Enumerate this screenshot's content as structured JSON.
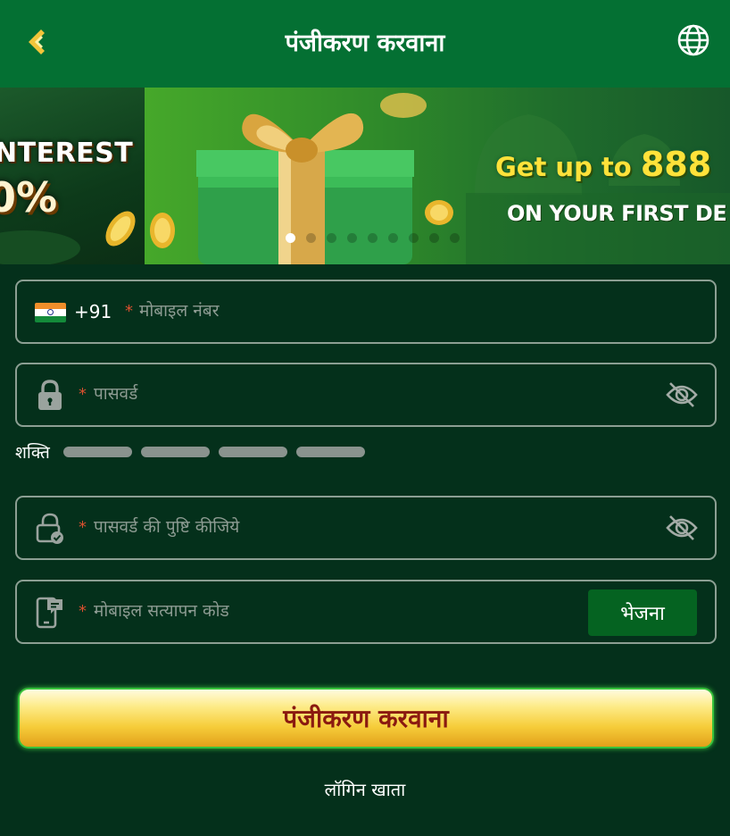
{
  "header": {
    "title": "पंजीकरण करवाना"
  },
  "banner": {
    "left_line1": "NTEREST",
    "left_line2": "0%",
    "right_line1_prefix": "Get up to",
    "right_line1_amount": "888",
    "right_line2": "ON YOUR FIRST DE",
    "slide_count": 9,
    "active_slide": 1
  },
  "form": {
    "phone": {
      "country_code": "+91",
      "required_mark": "*",
      "placeholder": "मोबाइल नंबर"
    },
    "password": {
      "required_mark": "*",
      "placeholder": "पासवर्ड"
    },
    "strength": {
      "label": "शक्ति",
      "segments": 4
    },
    "confirm_password": {
      "required_mark": "*",
      "placeholder": "पासवर्ड की पुष्टि कीजिये"
    },
    "otp": {
      "required_mark": "*",
      "placeholder": "मोबाइल सत्यापन कोड",
      "send_label": "भेजना"
    }
  },
  "actions": {
    "register_label": "पंजीकरण करवाना",
    "login_label": "लॉगिन खाता"
  },
  "colors": {
    "header_bg": "#047033",
    "page_bg": "#04301b",
    "field_border": "#8c9f93",
    "send_bg": "#056321",
    "register_text": "#8a1a10",
    "required_mark": "#d9502f"
  },
  "icons": {
    "back": "chevron-left-gold-icon",
    "language": "globe-icon",
    "flag": "india-flag-icon",
    "password": "lock-icon",
    "confirm_password": "lock-check-icon",
    "otp": "phone-message-icon",
    "toggle_visibility": "eye-off-icon"
  }
}
